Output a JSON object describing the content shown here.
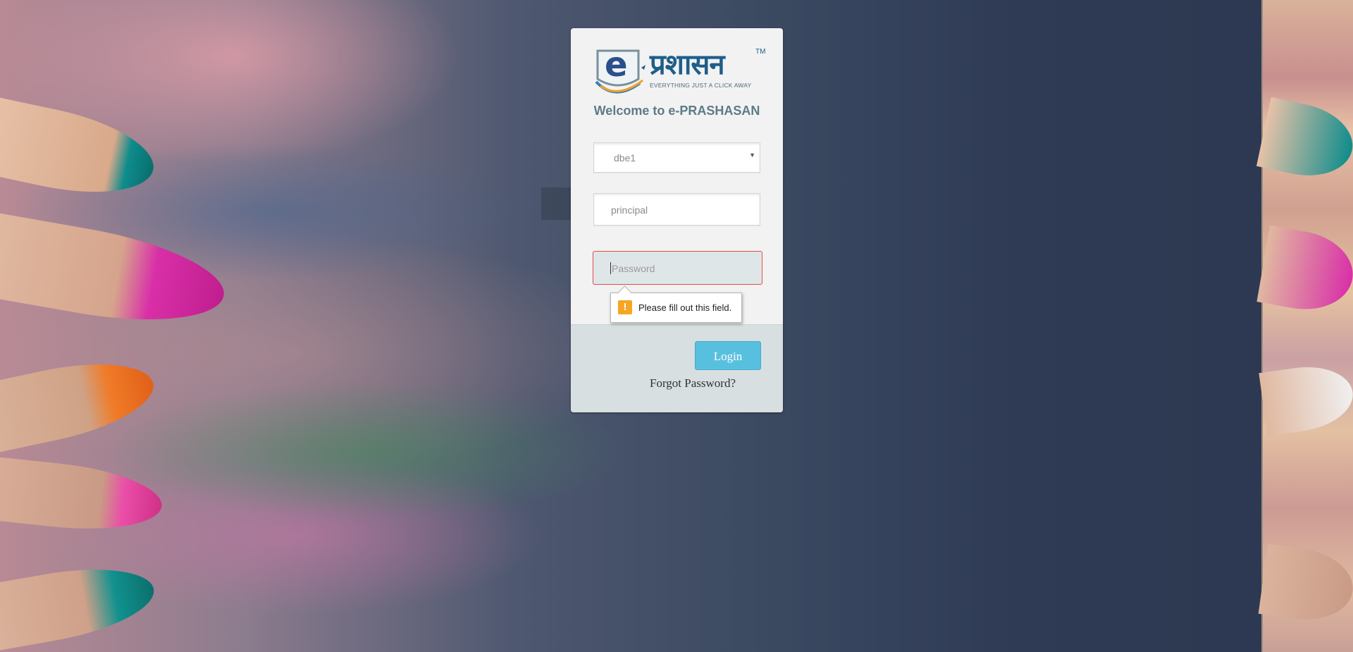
{
  "brand": {
    "logo_letter": "e",
    "logo_hindi": "प्रशासन",
    "logo_tm": "TM",
    "tagline": "EVERYTHING JUST A CLICK AWAY"
  },
  "welcome": "Welcome to e-PRASHASAN",
  "form": {
    "database_select_value": "dbe1",
    "username_value": "principal",
    "password_placeholder": "Password",
    "validation_message": "Please fill out this field.",
    "login_label": "Login",
    "forgot_label": "Forgot Password?"
  },
  "colors": {
    "card_bg": "#f2f2f2",
    "footer_bg": "#d7dfe1",
    "login_button": "#58c0df",
    "error_border": "#e14d4d",
    "welcome_text": "#5d7b86",
    "warning_icon": "#f5a623"
  }
}
